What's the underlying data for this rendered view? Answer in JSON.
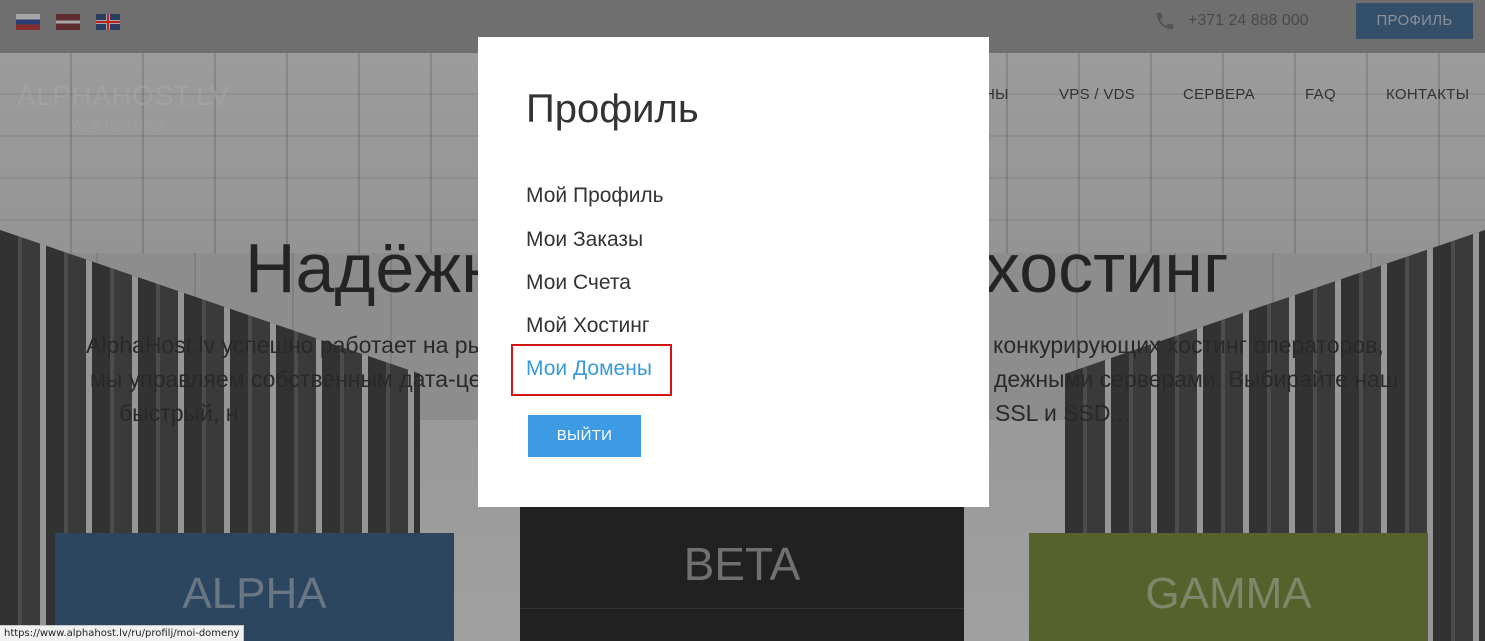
{
  "topbar": {
    "phone": "+371 24 888 000",
    "profile_button": "ПРОФИЛЬ"
  },
  "logo": {
    "title": "ALPHAHOST.LV",
    "subtitle": "WEB HOSTING"
  },
  "nav": {
    "items": [
      {
        "label": "НЫ"
      },
      {
        "label": "VPS / VDS"
      },
      {
        "label": "СЕРВЕРА"
      },
      {
        "label": "FAQ"
      },
      {
        "label": "КОНТАКТЫ"
      }
    ]
  },
  "hero": {
    "headline_left": "Надёжн",
    "headline_right": "хостинг",
    "intro_line1_left": "AlphaHost.lv успешно работает на ры",
    "intro_line1_right": "конкурирующих хостинг операторов,",
    "intro_line2_left": "мы управляем собственным дата-це",
    "intro_line2_right": "дежными серверами. Выбирайте наш",
    "intro_line3_left": "быстрый, н",
    "intro_line3_right": "SSL и SSD..."
  },
  "plans": [
    {
      "name": "ALPHA",
      "color": "#1f4f7d"
    },
    {
      "name": "BETA",
      "color": "#0c0c0c"
    },
    {
      "name": "GAMMA",
      "color": "#6a8220"
    }
  ],
  "modal": {
    "title": "Профиль",
    "links": [
      {
        "label": "Мой Профиль"
      },
      {
        "label": "Мои Заказы"
      },
      {
        "label": "Мои Счета"
      },
      {
        "label": "Мой Хостинг"
      },
      {
        "label": "Мои Домены",
        "active": true
      }
    ],
    "logout_button": "ВЫЙТИ",
    "accent_color": "#3a9ad9",
    "highlight_color": "#d21414"
  },
  "statusbar": {
    "url": "https://www.alphahost.lv/ru/profilj/moi-domeny"
  },
  "icons": {
    "phone": "phone-icon"
  }
}
